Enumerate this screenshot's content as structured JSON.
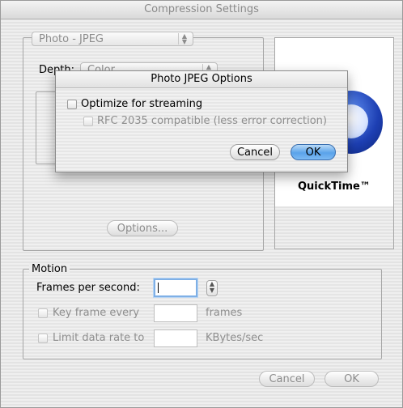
{
  "window": {
    "title": "Compression Settings"
  },
  "compressor": {
    "type_value": "Photo - JPEG",
    "depth_label": "Depth:",
    "depth_value": "Color",
    "options_button": "Options..."
  },
  "preview": {
    "brand": "QuickTime™"
  },
  "motion": {
    "group_label": "Motion",
    "fps_label": "Frames per second:",
    "fps_value": "",
    "keyframe_label": "Key frame every",
    "keyframe_unit": "frames",
    "limit_label": "Limit data rate to",
    "limit_unit": "KBytes/sec"
  },
  "buttons": {
    "cancel": "Cancel",
    "ok": "OK"
  },
  "sheet": {
    "title": "Photo JPEG Options",
    "optimize_label": "Optimize for streaming",
    "rfc_label": "RFC 2035 compatible (less error correction)",
    "cancel": "Cancel",
    "ok": "OK"
  },
  "colors": {
    "default_button": "#5aa3ea",
    "disabled_text": "#8e8e8e"
  }
}
